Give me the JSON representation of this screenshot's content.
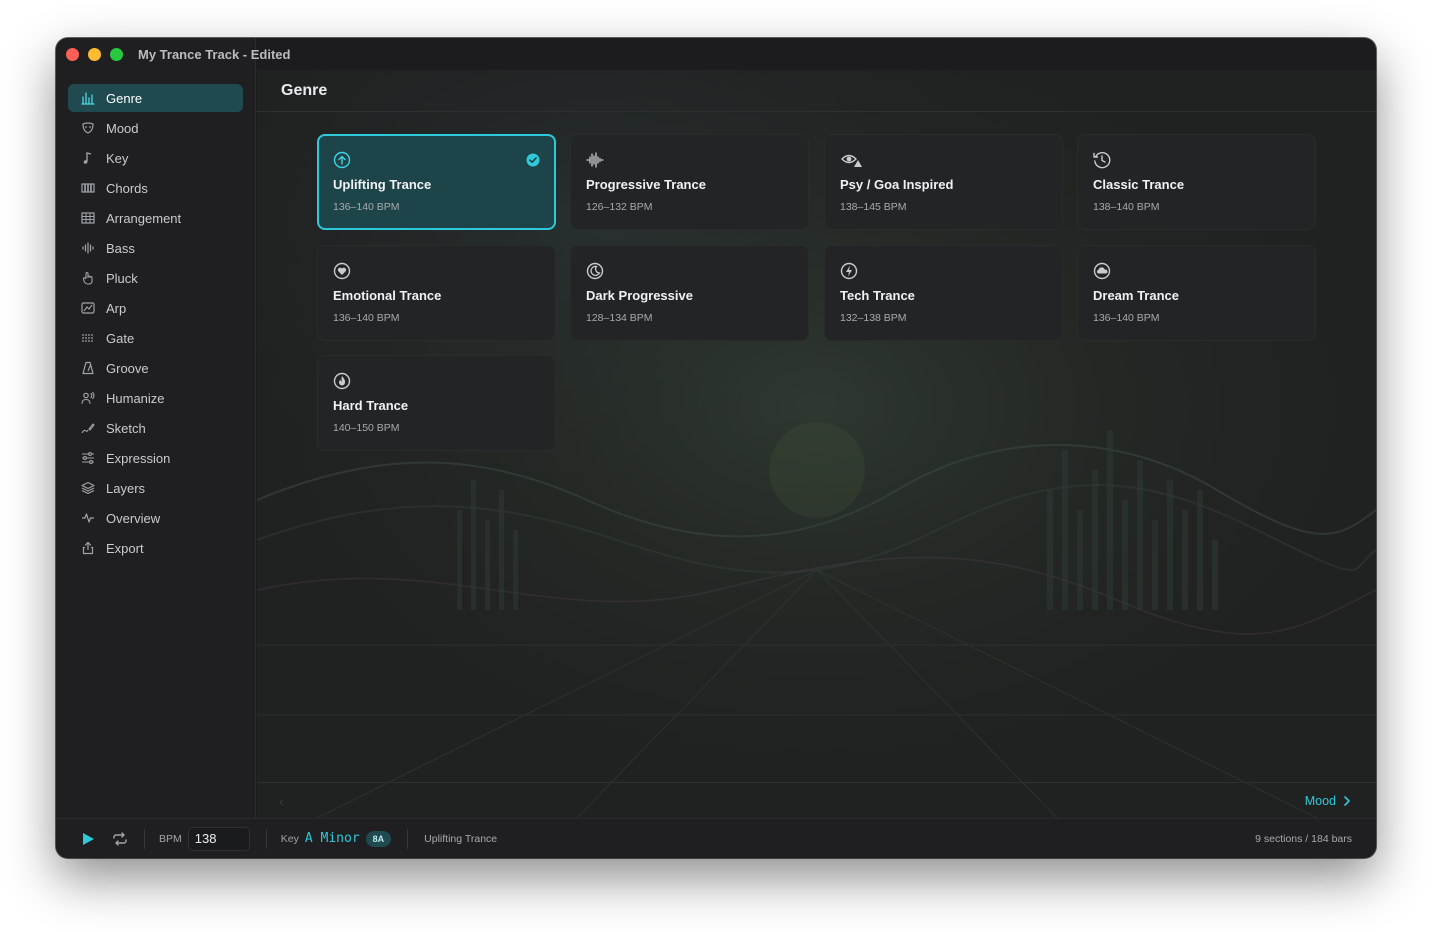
{
  "window": {
    "title": "My Trance Track - Edited",
    "traffic_lights": [
      {
        "name": "close",
        "color": "#ff5f57"
      },
      {
        "name": "minimize",
        "color": "#febc2e"
      },
      {
        "name": "zoom",
        "color": "#28c840"
      }
    ]
  },
  "sidebar": {
    "items": [
      {
        "label": "Genre",
        "icon": "equalizer-icon",
        "active": true
      },
      {
        "label": "Mood",
        "icon": "mood-mask-icon"
      },
      {
        "label": "Key",
        "icon": "music-note-icon"
      },
      {
        "label": "Chords",
        "icon": "piano-keys-icon"
      },
      {
        "label": "Arrangement",
        "icon": "grid-table-icon"
      },
      {
        "label": "Bass",
        "icon": "waveform-bars-icon"
      },
      {
        "label": "Pluck",
        "icon": "hand-pointer-icon"
      },
      {
        "label": "Arp",
        "icon": "arp-chart-icon"
      },
      {
        "label": "Gate",
        "icon": "dots-grid-icon"
      },
      {
        "label": "Groove",
        "icon": "metronome-icon"
      },
      {
        "label": "Humanize",
        "icon": "person-wave-icon"
      },
      {
        "label": "Sketch",
        "icon": "pencil-line-icon"
      },
      {
        "label": "Expression",
        "icon": "sliders-icon"
      },
      {
        "label": "Layers",
        "icon": "layers-icon"
      },
      {
        "label": "Overview",
        "icon": "pulse-icon"
      },
      {
        "label": "Export",
        "icon": "share-icon"
      }
    ]
  },
  "main": {
    "title": "Genre",
    "genres": [
      {
        "name": "Uplifting Trance",
        "bpm": "136–140 BPM",
        "icon": "arrow-up-circle-icon",
        "selected": true
      },
      {
        "name": "Progressive Trance",
        "bpm": "126–132 BPM",
        "icon": "waveform-icon"
      },
      {
        "name": "Psy / Goa Inspired",
        "bpm": "138–145 BPM",
        "icon": "eye-triangle-icon"
      },
      {
        "name": "Classic Trance",
        "bpm": "138–140 BPM",
        "icon": "clock-history-icon"
      },
      {
        "name": "Emotional Trance",
        "bpm": "136–140 BPM",
        "icon": "heart-circle-icon"
      },
      {
        "name": "Dark Progressive",
        "bpm": "128–134 BPM",
        "icon": "moon-circle-icon"
      },
      {
        "name": "Tech Trance",
        "bpm": "132–138 BPM",
        "icon": "bolt-circle-icon"
      },
      {
        "name": "Dream Trance",
        "bpm": "136–140 BPM",
        "icon": "cloud-circle-icon"
      },
      {
        "name": "Hard Trance",
        "bpm": "140–150 BPM",
        "icon": "flame-circle-icon"
      }
    ],
    "next_label": "Mood"
  },
  "transport": {
    "bpm_label": "BPM",
    "bpm_value": "138",
    "key_label": "Key",
    "key_value": "A Minor",
    "key_camelot": "8A",
    "genre": "Uplifting Trance",
    "stats": "9 sections / 184 bars"
  },
  "colors": {
    "accent": "#2fc9dc",
    "selected_card": "#1d4448",
    "active_nav": "#1f4a4f"
  }
}
